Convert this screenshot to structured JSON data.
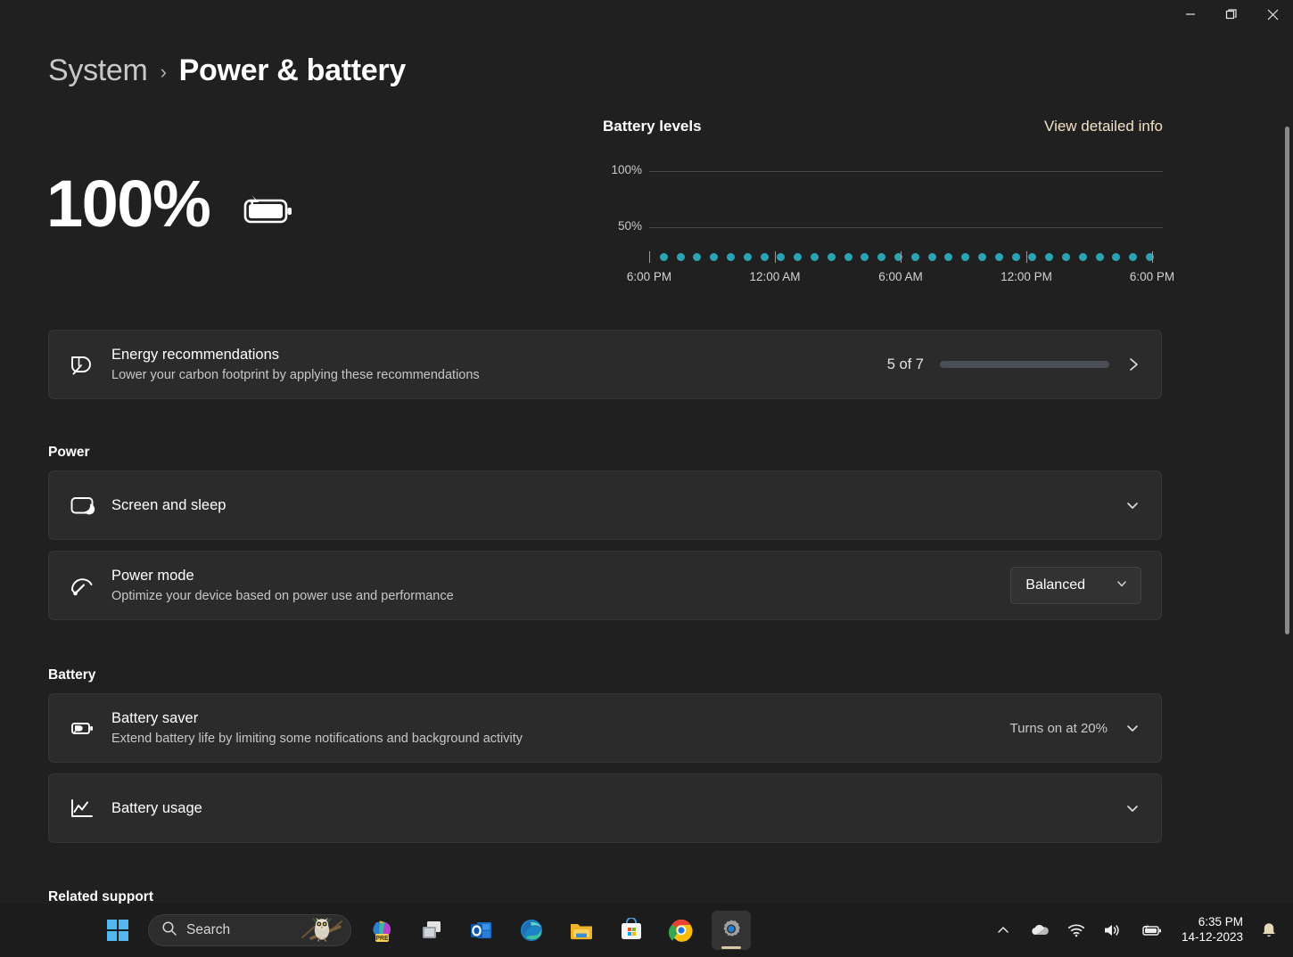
{
  "window": {
    "minimize_label": "Minimize",
    "restore_label": "Restore",
    "close_label": "Close"
  },
  "breadcrumb": {
    "parent": "System",
    "separator": "›",
    "current": "Power & battery"
  },
  "battery_status": {
    "percent_label": "100%",
    "icon": "battery-charging-icon"
  },
  "chart_panel": {
    "title": "Battery levels",
    "detail_link": "View detailed info"
  },
  "chart_data": {
    "type": "scatter",
    "title": "Battery levels",
    "xlabel": "",
    "ylabel": "",
    "ylim": [
      0,
      100
    ],
    "ytick_labels": [
      "100%",
      "50%"
    ],
    "ytick_values": [
      100,
      50
    ],
    "xtick_labels": [
      "6:00 PM",
      "12:00 AM",
      "6:00 AM",
      "12:00 PM",
      "6:00 PM"
    ],
    "xtick_values": [
      0,
      6,
      12,
      18,
      24
    ],
    "grid": true,
    "legend": false,
    "series": [
      {
        "name": "Battery level",
        "color": "#2aa3b2",
        "x": [
          0.5,
          1.3,
          2.1,
          2.9,
          3.7,
          4.5,
          5.3,
          6.1,
          6.9,
          7.7,
          8.5,
          9.3,
          10.1,
          10.9,
          11.7,
          12.5,
          13.3,
          14.1,
          14.9,
          15.7,
          16.5,
          17.3,
          18.1,
          18.9,
          19.7,
          20.5,
          21.3,
          22.1,
          22.9,
          23.7
        ],
        "y": [
          3,
          3,
          3,
          3,
          3,
          3,
          3,
          3,
          3,
          3,
          3,
          3,
          3,
          3,
          3,
          3,
          3,
          3,
          3,
          3,
          3,
          3,
          3,
          3,
          3,
          3,
          3,
          3,
          3,
          3
        ]
      }
    ]
  },
  "energy_card": {
    "icon": "leaf-eco-icon",
    "title": "Energy recommendations",
    "subtitle": "Lower your carbon footprint by applying these recommendations",
    "progress_label": "5 of 7",
    "progress_value": 5,
    "progress_max": 7,
    "progress_percent": 71,
    "fill_color": "#a87a51",
    "track_color": "#4a4e54",
    "chevron": "chevron-right-icon"
  },
  "sections": {
    "power_heading": "Power",
    "battery_heading": "Battery",
    "related_heading": "Related support"
  },
  "power_cards": [
    {
      "icon": "screen-sleep-icon",
      "title": "Screen and sleep",
      "subtitle": "",
      "right_type": "expand",
      "right_text": ""
    },
    {
      "icon": "power-mode-gauge-icon",
      "title": "Power mode",
      "subtitle": "Optimize your device based on power use and performance",
      "right_type": "combo",
      "right_text": "Balanced"
    }
  ],
  "battery_cards": [
    {
      "icon": "battery-saver-icon",
      "title": "Battery saver",
      "subtitle": "Extend battery life by limiting some notifications and background activity",
      "right_type": "note-expand",
      "right_text": "Turns on at 20%"
    },
    {
      "icon": "battery-usage-chart-icon",
      "title": "Battery usage",
      "subtitle": "",
      "right_type": "expand",
      "right_text": ""
    }
  ],
  "taskbar": {
    "start_label": "Start",
    "search_placeholder": "Search",
    "search_value": "",
    "items": [
      {
        "name": "copilot-icon",
        "label": "Copilot (PRE)"
      },
      {
        "name": "task-view-icon",
        "label": "Task View"
      },
      {
        "name": "outlook-icon",
        "label": "Outlook"
      },
      {
        "name": "edge-icon",
        "label": "Microsoft Edge"
      },
      {
        "name": "file-explorer-icon",
        "label": "File Explorer"
      },
      {
        "name": "microsoft-store-icon",
        "label": "Microsoft Store"
      },
      {
        "name": "chrome-icon",
        "label": "Google Chrome"
      },
      {
        "name": "settings-icon",
        "label": "Settings"
      }
    ],
    "tray": {
      "overflow": "chevron-up-icon",
      "onedrive": "onedrive-icon",
      "wifi": "wifi-icon",
      "volume": "volume-icon",
      "battery": "battery-charging-icon",
      "time": "6:35 PM",
      "date": "14-12-2023",
      "notifications": "bell-icon"
    }
  }
}
